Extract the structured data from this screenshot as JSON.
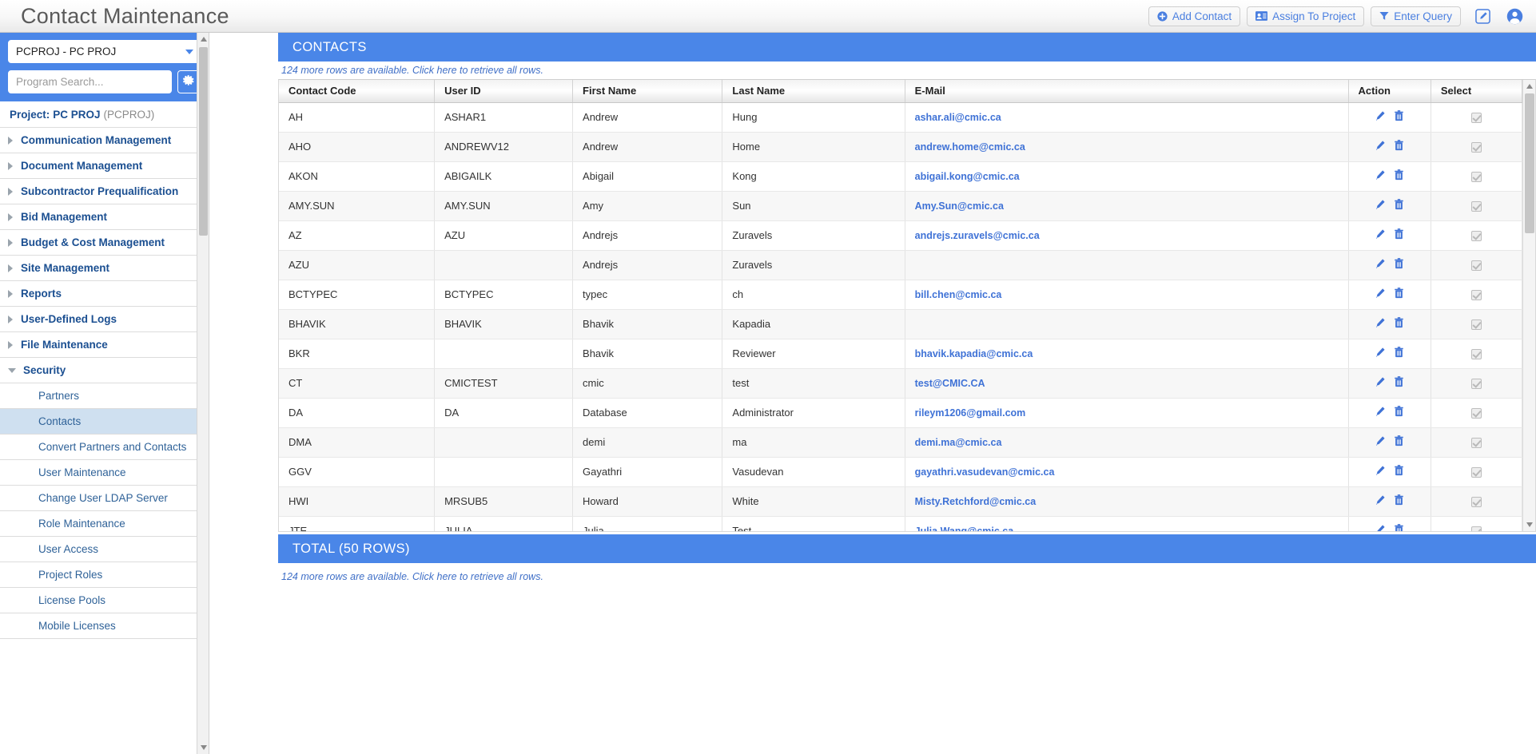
{
  "app": {
    "title": "Contact Maintenance"
  },
  "toolbar": {
    "add_contact_label": "Add Contact",
    "assign_to_project_label": "Assign To Project",
    "enter_query_label": "Enter Query",
    "edit_icon_name": "edit-square-icon",
    "user_icon_name": "user-account-icon"
  },
  "sidebar": {
    "project_select_value": "PCPROJ - PC PROJ",
    "search_placeholder": "Program Search...",
    "search_value": "",
    "gear_icon_name": "gear-icon",
    "project_line": {
      "label": "Project:",
      "name": "PC PROJ",
      "code": "(PCPROJ)"
    },
    "groups": [
      {
        "label": "Communication Management",
        "expanded": false
      },
      {
        "label": "Document Management",
        "expanded": false
      },
      {
        "label": "Subcontractor Prequalification",
        "expanded": false
      },
      {
        "label": "Bid Management",
        "expanded": false
      },
      {
        "label": "Budget & Cost Management",
        "expanded": false
      },
      {
        "label": "Site Management",
        "expanded": false
      },
      {
        "label": "Reports",
        "expanded": false
      },
      {
        "label": "User-Defined Logs",
        "expanded": false
      },
      {
        "label": "File Maintenance",
        "expanded": false
      },
      {
        "label": "Security",
        "expanded": true
      }
    ],
    "security_children": [
      {
        "label": "Partners",
        "active": false
      },
      {
        "label": "Contacts",
        "active": true
      },
      {
        "label": "Convert Partners and Contacts",
        "active": false
      },
      {
        "label": "User Maintenance",
        "active": false
      },
      {
        "label": "Change User LDAP Server",
        "active": false
      },
      {
        "label": "Role Maintenance",
        "active": false
      },
      {
        "label": "User Access",
        "active": false
      },
      {
        "label": "Project Roles",
        "active": false
      },
      {
        "label": "License Pools",
        "active": false
      },
      {
        "label": "Mobile Licenses",
        "active": false
      }
    ]
  },
  "panel": {
    "title": "CONTACTS",
    "notice": "124 more rows are available. Click here to retrieve all rows.",
    "notice_bottom": "124 more rows are available. Click here to retrieve all rows.",
    "total_label": "TOTAL (50 ROWS)"
  },
  "grid": {
    "columns": [
      "Contact Code",
      "User ID",
      "First Name",
      "Last Name",
      "E-Mail",
      "Action",
      "Select"
    ],
    "rows": [
      {
        "contact_code": "AH",
        "user_id": "ASHAR1",
        "first_name": "Andrew",
        "last_name": "Hung",
        "email": "ashar.ali@cmic.ca"
      },
      {
        "contact_code": "AHO",
        "user_id": "ANDREWV12",
        "first_name": "Andrew",
        "last_name": "Home",
        "email": "andrew.home@cmic.ca"
      },
      {
        "contact_code": "AKON",
        "user_id": "ABIGAILK",
        "first_name": "Abigail",
        "last_name": "Kong",
        "email": "abigail.kong@cmic.ca"
      },
      {
        "contact_code": "AMY.SUN",
        "user_id": "AMY.SUN",
        "first_name": "Amy",
        "last_name": "Sun",
        "email": "Amy.Sun@cmic.ca"
      },
      {
        "contact_code": "AZ",
        "user_id": "AZU",
        "first_name": "Andrejs",
        "last_name": "Zuravels",
        "email": "andrejs.zuravels@cmic.ca"
      },
      {
        "contact_code": "AZU",
        "user_id": "",
        "first_name": "Andrejs",
        "last_name": "Zuravels",
        "email": ""
      },
      {
        "contact_code": "BCTYPEC",
        "user_id": "BCTYPEC",
        "first_name": "typec",
        "last_name": "ch",
        "email": "bill.chen@cmic.ca"
      },
      {
        "contact_code": "BHAVIK",
        "user_id": "BHAVIK",
        "first_name": "Bhavik",
        "last_name": "Kapadia",
        "email": ""
      },
      {
        "contact_code": "BKR",
        "user_id": "",
        "first_name": "Bhavik",
        "last_name": "Reviewer",
        "email": "bhavik.kapadia@cmic.ca"
      },
      {
        "contact_code": "CT",
        "user_id": "CMICTEST",
        "first_name": "cmic",
        "last_name": "test",
        "email": "test@CMIC.CA"
      },
      {
        "contact_code": "DA",
        "user_id": "DA",
        "first_name": "Database",
        "last_name": "Administrator",
        "email": "rileym1206@gmail.com"
      },
      {
        "contact_code": "DMA",
        "user_id": "",
        "first_name": "demi",
        "last_name": "ma",
        "email": "demi.ma@cmic.ca"
      },
      {
        "contact_code": "GGV",
        "user_id": "",
        "first_name": "Gayathri",
        "last_name": "Vasudevan",
        "email": "gayathri.vasudevan@cmic.ca"
      },
      {
        "contact_code": "HWI",
        "user_id": "MRSUB5",
        "first_name": "Howard",
        "last_name": "White",
        "email": "Misty.Retchford@cmic.ca"
      },
      {
        "contact_code": "JTE",
        "user_id": "JULIA",
        "first_name": "Julia",
        "last_name": "Test",
        "email": "Julia.Wang@cmic.ca"
      }
    ],
    "row_icons": {
      "edit_icon_name": "pencil-edit-icon",
      "delete_icon_name": "trash-delete-icon",
      "select_checkbox_name": "row-select-checkbox"
    }
  },
  "colors": {
    "accent": "#4a86e8",
    "link": "#3f72d6",
    "nav_text": "#1b4f91",
    "active_row": "#cfe0f0"
  }
}
